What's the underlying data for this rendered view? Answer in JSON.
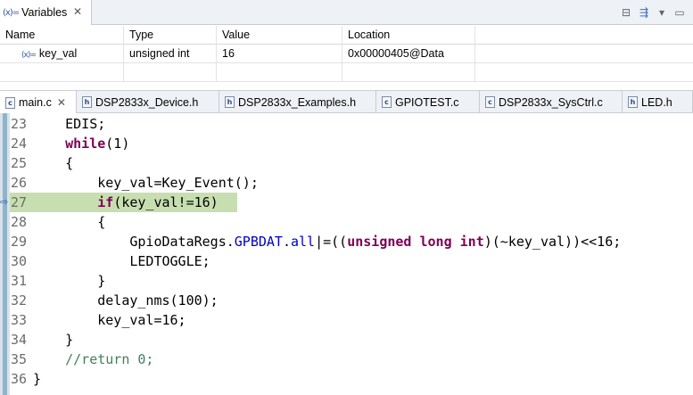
{
  "variables_view": {
    "tab_label": "Variables",
    "tab_icon": "(x)=",
    "columns": [
      "Name",
      "Type",
      "Value",
      "Location"
    ],
    "rows": [
      {
        "icon": "(x)=",
        "name": "key_val",
        "type": "unsigned int",
        "value": "16",
        "location": "0x00000405@Data"
      }
    ],
    "tool_icons": [
      "collapse-all-icon",
      "show-type-names-icon",
      "view-menu-icon",
      "minimize-icon",
      "maximize-icon"
    ]
  },
  "editor": {
    "tabs": [
      {
        "label": "main.c",
        "icon": "c",
        "active": true,
        "closable": true
      },
      {
        "label": "DSP2833x_Device.h",
        "icon": "h",
        "active": false
      },
      {
        "label": "DSP2833x_Examples.h",
        "icon": "h",
        "active": false
      },
      {
        "label": "GPIOTEST.c",
        "icon": "c",
        "active": false
      },
      {
        "label": "DSP2833x_SysCtrl.c",
        "icon": "c",
        "active": false
      },
      {
        "label": "LED.h",
        "icon": "h",
        "active": false
      }
    ],
    "current_line": 27,
    "lines": [
      {
        "n": "23",
        "indent": "    ",
        "tokens": [
          {
            "t": "EDIS;",
            "c": "plain"
          }
        ]
      },
      {
        "n": "24",
        "indent": "    ",
        "tokens": [
          {
            "t": "while",
            "c": "kw"
          },
          {
            "t": "(1)",
            "c": "plain"
          }
        ]
      },
      {
        "n": "25",
        "indent": "    ",
        "tokens": [
          {
            "t": "{",
            "c": "plain"
          }
        ]
      },
      {
        "n": "26",
        "indent": "        ",
        "tokens": [
          {
            "t": "key_val=Key_Event();",
            "c": "plain"
          }
        ]
      },
      {
        "n": "27",
        "indent": "        ",
        "tokens": [
          {
            "t": "if",
            "c": "kw"
          },
          {
            "t": "(key_val!=16)",
            "c": "plain"
          }
        ]
      },
      {
        "n": "28",
        "indent": "        ",
        "tokens": [
          {
            "t": "{",
            "c": "plain"
          }
        ]
      },
      {
        "n": "29",
        "indent": "            ",
        "tokens": [
          {
            "t": "GpioDataRegs.",
            "c": "plain"
          },
          {
            "t": "GPBDAT",
            "c": "field"
          },
          {
            "t": ".",
            "c": "plain"
          },
          {
            "t": "all",
            "c": "field"
          },
          {
            "t": "|=((",
            "c": "plain"
          },
          {
            "t": "unsigned long int",
            "c": "kw"
          },
          {
            "t": ")(~key_val))<<16;",
            "c": "plain"
          }
        ]
      },
      {
        "n": "30",
        "indent": "            ",
        "tokens": [
          {
            "t": "LEDTOGGLE;",
            "c": "plain"
          }
        ]
      },
      {
        "n": "31",
        "indent": "        ",
        "tokens": [
          {
            "t": "}",
            "c": "plain"
          }
        ]
      },
      {
        "n": "32",
        "indent": "        ",
        "tokens": [
          {
            "t": "delay_nms(100);",
            "c": "plain"
          }
        ]
      },
      {
        "n": "33",
        "indent": "        ",
        "tokens": [
          {
            "t": "key_val=16;",
            "c": "plain"
          }
        ]
      },
      {
        "n": "34",
        "indent": "    ",
        "tokens": [
          {
            "t": "}",
            "c": "plain"
          }
        ]
      },
      {
        "n": "35",
        "indent": "    ",
        "tokens": [
          {
            "t": "//return 0;",
            "c": "comment"
          }
        ]
      },
      {
        "n": "36",
        "indent": "",
        "tokens": [
          {
            "t": "}",
            "c": "plain"
          }
        ]
      }
    ]
  }
}
